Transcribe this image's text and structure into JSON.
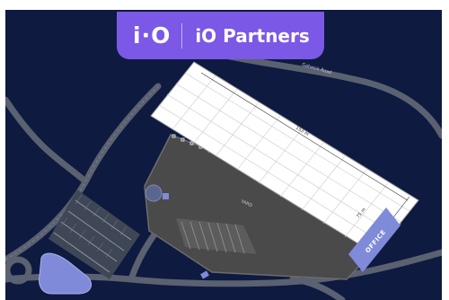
{
  "brand": {
    "logo_text": "i·O",
    "name": "iO Partners",
    "accent_color": "#7b58e6"
  },
  "site_plan": {
    "background_color": "#0e1a3f",
    "office_label": "OFFICE",
    "width_dimension_label": "153 m",
    "depth_dimension_label": "75 m",
    "yard_label": "YARD",
    "road_label": "Gatwick Road"
  }
}
